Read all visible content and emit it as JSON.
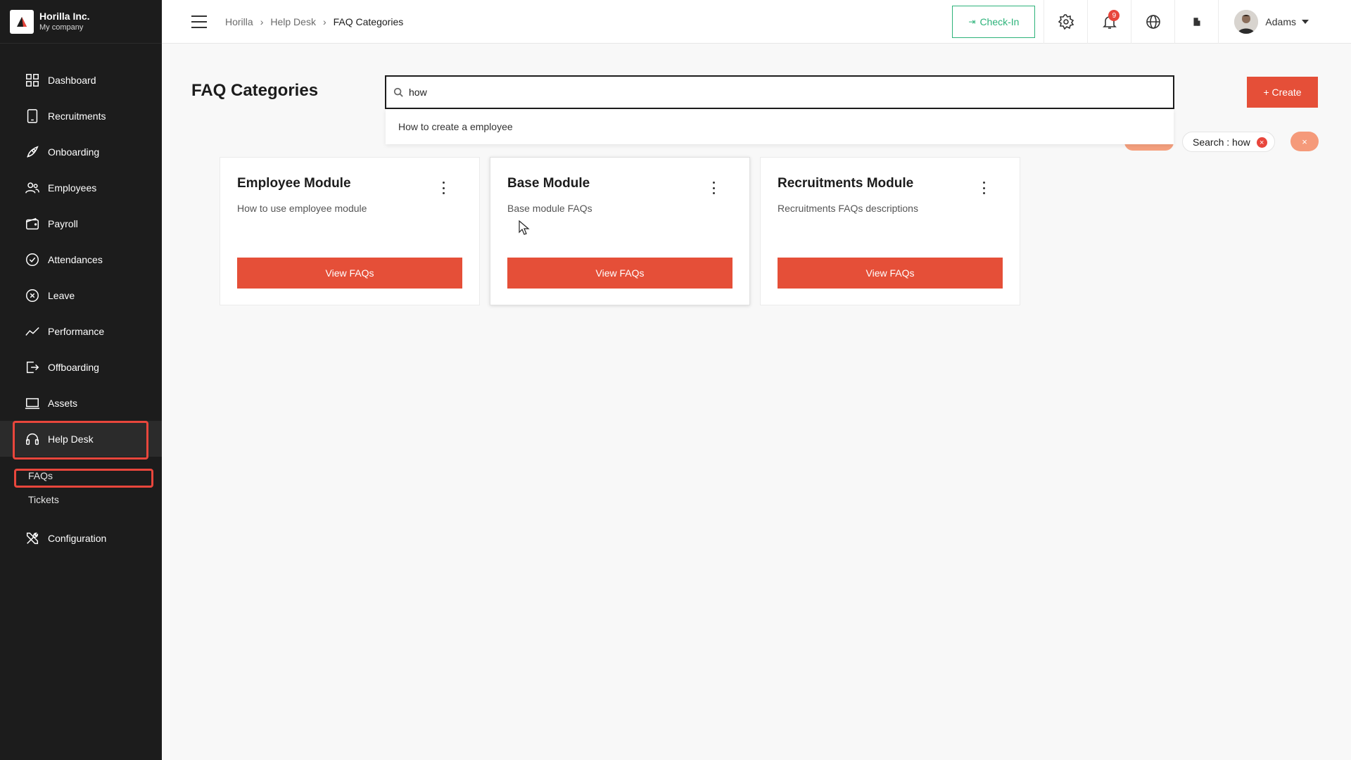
{
  "brand": {
    "name": "Horilla Inc.",
    "subtitle": "My company"
  },
  "sidebar": {
    "items": [
      {
        "label": "Dashboard",
        "icon": "grid-icon"
      },
      {
        "label": "Recruitments",
        "icon": "tablet-icon"
      },
      {
        "label": "Onboarding",
        "icon": "rocket-icon"
      },
      {
        "label": "Employees",
        "icon": "people-icon"
      },
      {
        "label": "Payroll",
        "icon": "wallet-icon"
      },
      {
        "label": "Attendances",
        "icon": "check-circle-icon"
      },
      {
        "label": "Leave",
        "icon": "x-circle-icon"
      },
      {
        "label": "Performance",
        "icon": "trend-icon"
      },
      {
        "label": "Offboarding",
        "icon": "exit-icon"
      },
      {
        "label": "Assets",
        "icon": "laptop-icon"
      },
      {
        "label": "Help Desk",
        "icon": "headset-icon"
      }
    ],
    "subitems": [
      {
        "label": "FAQs"
      },
      {
        "label": "Tickets"
      }
    ],
    "config": {
      "label": "Configuration",
      "icon": "tools-icon"
    }
  },
  "header": {
    "breadcrumbs": [
      "Horilla",
      "Help Desk",
      "FAQ Categories"
    ],
    "checkin_label": "Check-In",
    "notification_count": "9",
    "user_name": "Adams"
  },
  "main": {
    "title": "FAQ Categories",
    "search": {
      "value": "how",
      "suggestion": "How to create a employee"
    },
    "create_label": "+ Create",
    "filter_tag": "Search : how",
    "clear_label": "×"
  },
  "cards": [
    {
      "title": "Employee Module",
      "description": "How to use employee module",
      "button": "View FAQs"
    },
    {
      "title": "Base Module",
      "description": "Base module FAQs",
      "button": "View FAQs"
    },
    {
      "title": "Recruitments Module",
      "description": "Recruitments FAQs descriptions",
      "button": "View FAQs"
    }
  ],
  "colors": {
    "accent": "#e54f38",
    "sidebar_bg": "#1c1c1c",
    "checkin": "#2db37a",
    "highlight": "#e8463c"
  }
}
